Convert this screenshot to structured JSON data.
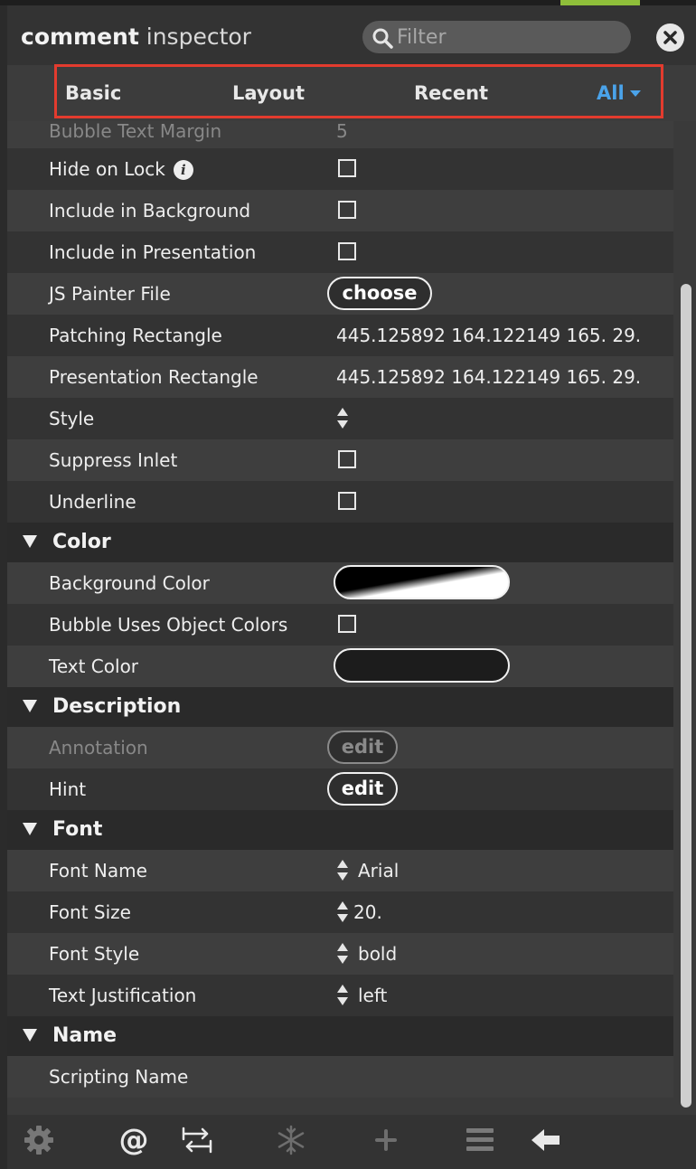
{
  "window": {
    "title_bold": "comment",
    "title_light": " inspector"
  },
  "filter": {
    "placeholder": "Filter"
  },
  "tabs": [
    {
      "label": "Basic",
      "active": false
    },
    {
      "label": "Layout",
      "active": false
    },
    {
      "label": "Recent",
      "active": false
    },
    {
      "label": "All",
      "active": true
    }
  ],
  "rows_top": [
    {
      "label": "Bubble Text Margin",
      "type": "value",
      "value": "5",
      "dim": true
    },
    {
      "label": "Hide on Lock",
      "type": "checkbox",
      "checked": false,
      "info_icon": "i"
    },
    {
      "label": "Include in Background",
      "type": "checkbox",
      "checked": false
    },
    {
      "label": "Include in Presentation",
      "type": "checkbox",
      "checked": false
    },
    {
      "label": "JS Painter File",
      "type": "button",
      "button_label": "choose"
    },
    {
      "label": "Patching Rectangle",
      "type": "value",
      "value": "445.125892 164.122149 165. 29."
    },
    {
      "label": "Presentation Rectangle",
      "type": "value",
      "value": "445.125892 164.122149 165. 29."
    },
    {
      "label": "Style",
      "type": "stepper",
      "value": ""
    },
    {
      "label": "Suppress Inlet",
      "type": "checkbox",
      "checked": false
    },
    {
      "label": "Underline",
      "type": "checkbox",
      "checked": false
    }
  ],
  "sections": {
    "color": {
      "title": "Color",
      "rows": [
        {
          "label": "Background Color",
          "type": "swatch",
          "swatch": "black-white-gradient"
        },
        {
          "label": "Bubble Uses Object Colors",
          "type": "checkbox",
          "checked": false
        },
        {
          "label": "Text Color",
          "type": "swatch",
          "swatch": "#1c1c1c"
        }
      ]
    },
    "description": {
      "title": "Description",
      "rows": [
        {
          "label": "Annotation",
          "type": "button",
          "button_label": "edit",
          "disabled": true
        },
        {
          "label": "Hint",
          "type": "button",
          "button_label": "edit",
          "disabled": false
        }
      ]
    },
    "font": {
      "title": "Font",
      "rows": [
        {
          "label": "Font Name",
          "type": "stepper",
          "value": "Arial"
        },
        {
          "label": "Font Size",
          "type": "stepper",
          "value": "20."
        },
        {
          "label": "Font Style",
          "type": "stepper",
          "value": "bold"
        },
        {
          "label": "Text Justification",
          "type": "stepper",
          "value": "left"
        }
      ]
    },
    "name": {
      "title": "Name",
      "rows": [
        {
          "label": "Scripting Name",
          "type": "value",
          "value": ""
        }
      ]
    }
  },
  "toolbar": {
    "icons": [
      "gear-icon",
      "at-icon",
      "swap-arrows-icon",
      "snowflake-icon",
      "plus-icon",
      "list-icon",
      "back-arrow-icon"
    ],
    "at_glyph": "@"
  },
  "colors": {
    "accent": "#4aa3ea",
    "highlight_border": "#e33b2e",
    "panel_bg": "#3a3a3a"
  }
}
